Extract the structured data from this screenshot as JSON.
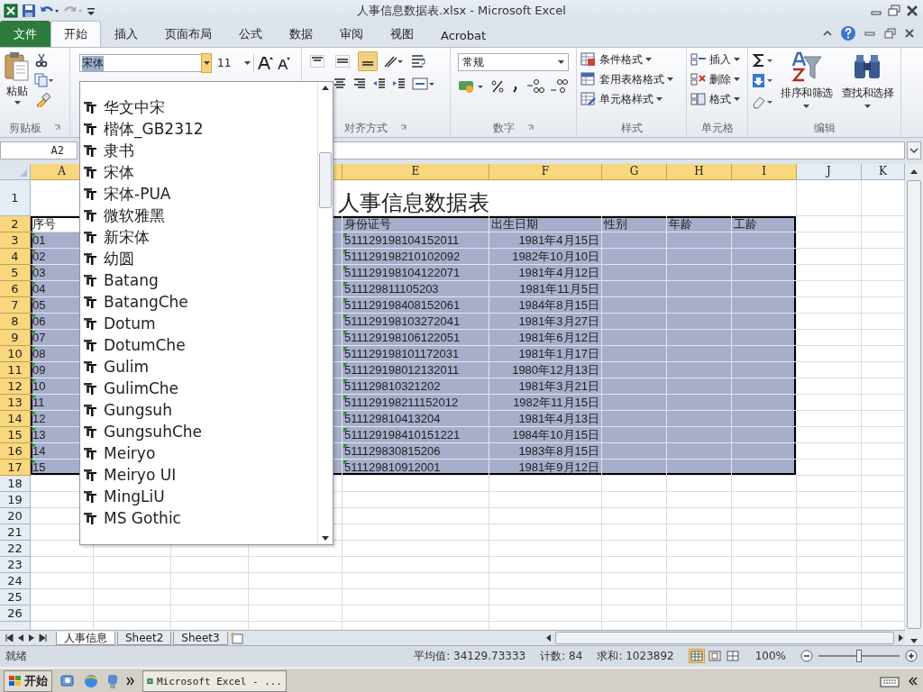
{
  "window": {
    "title": "人事信息数据表.xlsx - Microsoft Excel"
  },
  "ribbon_tabs": [
    {
      "label": "文件",
      "kind": "file",
      "selected": false
    },
    {
      "label": "开始",
      "kind": "tab",
      "selected": true
    },
    {
      "label": "插入",
      "kind": "tab",
      "selected": false
    },
    {
      "label": "页面布局",
      "kind": "tab",
      "selected": false
    },
    {
      "label": "公式",
      "kind": "tab",
      "selected": false
    },
    {
      "label": "数据",
      "kind": "tab",
      "selected": false
    },
    {
      "label": "审阅",
      "kind": "tab",
      "selected": false
    },
    {
      "label": "视图",
      "kind": "tab",
      "selected": false
    },
    {
      "label": "Acrobat",
      "kind": "tab",
      "selected": false
    }
  ],
  "clipboard": {
    "paste_label": "粘贴",
    "group_label": "剪贴板"
  },
  "font": {
    "name": "宋体",
    "size": "11"
  },
  "alignment": {
    "vertical": [
      {
        "selected": false
      },
      {
        "selected": false
      },
      {
        "selected": true
      }
    ],
    "group_label": "对齐方式"
  },
  "number": {
    "format": "常规",
    "group_label": "数字"
  },
  "styles": {
    "commands": [
      "条件格式",
      "套用表格格式",
      "单元格样式"
    ],
    "group_label": "样式"
  },
  "cells": {
    "commands": [
      "插入",
      "删除",
      "格式"
    ],
    "group_label": "单元格"
  },
  "editing": {
    "commands": [
      "排序和筛选",
      "查找和选择"
    ],
    "group_label": "编辑"
  },
  "name_box": "A2",
  "font_list": [
    "华文中宋",
    "楷体_GB2312",
    "隶书",
    "宋体",
    "宋体-PUA",
    "微软雅黑",
    "新宋体",
    "幼圆",
    "Batang",
    "BatangChe",
    "Dotum",
    "DotumChe",
    "Gulim",
    "GulimChe",
    "Gungsuh",
    "GungsuhChe",
    "Meiryo",
    "Meiryo UI",
    "MingLiU",
    "MS Gothic"
  ],
  "columns": [
    {
      "label": "A",
      "selected": true
    },
    {},
    {},
    {
      "selected": true
    },
    {
      "label": "E",
      "selected": true
    },
    {
      "label": "F",
      "selected": true
    },
    {
      "label": "G",
      "selected": true
    },
    {
      "label": "H",
      "selected": true
    },
    {
      "label": "I",
      "selected": true
    },
    {
      "label": "J",
      "selected": false
    },
    {
      "label": "K",
      "selected": false
    }
  ],
  "rows": [
    {
      "label": "1",
      "selected": false
    },
    {
      "label": "2",
      "selected": true
    },
    {
      "label": "3",
      "selected": true
    },
    {
      "label": "4",
      "selected": true
    },
    {
      "label": "5",
      "selected": true
    },
    {
      "label": "6",
      "selected": true
    },
    {
      "label": "7",
      "selected": true
    },
    {
      "label": "8",
      "selected": true
    },
    {
      "label": "9",
      "selected": true
    },
    {
      "label": "10",
      "selected": true
    },
    {
      "label": "11",
      "selected": true
    },
    {
      "label": "12",
      "selected": true
    },
    {
      "label": "13",
      "selected": true
    },
    {
      "label": "14",
      "selected": true
    },
    {
      "label": "15",
      "selected": true
    },
    {
      "label": "16",
      "selected": true
    },
    {
      "label": "17",
      "selected": true
    },
    {
      "label": "18",
      "selected": false
    },
    {
      "label": "19",
      "selected": false
    },
    {
      "label": "20",
      "selected": false
    },
    {
      "label": "21",
      "selected": false
    },
    {
      "label": "22",
      "selected": false
    },
    {
      "label": "23",
      "selected": false
    },
    {
      "label": "24",
      "selected": false
    },
    {
      "label": "25",
      "selected": false
    },
    {
      "label": "26",
      "selected": false
    }
  ],
  "sheet": {
    "title": "人事信息数据表",
    "header": [
      {
        "text": "序号",
        "active": true
      },
      {
        "text": "身份证号",
        "active": false
      },
      {
        "text": "出生日期",
        "active": false
      },
      {
        "text": "性别",
        "active": false
      },
      {
        "text": "年龄",
        "active": false
      },
      {
        "text": "工龄",
        "active": false
      }
    ],
    "records": [
      {
        "no": "01",
        "id_number": "511129198104152011",
        "birth_date": "1981年4月15日",
        "number_as_text": true
      },
      {
        "no": "02",
        "id_number": "511129198210102092",
        "birth_date": "1982年10月10日",
        "number_as_text": true
      },
      {
        "no": "03",
        "id_number": "511129198104122071",
        "birth_date": "1981年4月12日",
        "number_as_text": true
      },
      {
        "no": "04",
        "id_number": "511129811105203",
        "birth_date": "1981年11月5日",
        "number_as_text": true
      },
      {
        "no": "05",
        "id_number": "511129198408152061",
        "birth_date": "1984年8月15日",
        "number_as_text": true
      },
      {
        "no": "06",
        "id_number": "511129198103272041",
        "birth_date": "1981年3月27日",
        "number_as_text": true
      },
      {
        "no": "07",
        "id_number": "511129198106122051",
        "birth_date": "1981年6月12日",
        "number_as_text": true
      },
      {
        "no": "08",
        "id_number": "511129198101172031",
        "birth_date": "1981年1月17日",
        "number_as_text": true
      },
      {
        "no": "09",
        "id_number": "511129198012132011",
        "birth_date": "1980年12月13日",
        "number_as_text": true
      },
      {
        "no": "10",
        "id_number": "511129810321202",
        "birth_date": "1981年3月21日",
        "number_as_text": true
      },
      {
        "no": "11",
        "id_number": "511129198211152012",
        "birth_date": "1982年11月15日",
        "number_as_text": true
      },
      {
        "no": "12",
        "id_number": "511129810413204",
        "birth_date": "1981年4月13日",
        "number_as_text": true
      },
      {
        "no": "13",
        "id_number": "511129198410151221",
        "birth_date": "1984年10月15日",
        "number_as_text": true
      },
      {
        "no": "14",
        "id_number": "511129830815206",
        "birth_date": "1983年8月15日",
        "number_as_text": true
      },
      {
        "no": "15",
        "id_number": "511129810912001",
        "birth_date": "1981年9月12日",
        "number_as_text": true
      }
    ]
  },
  "sheet_tabs": [
    {
      "label": "人事信息",
      "selected": true
    },
    {
      "label": "Sheet2",
      "selected": false
    },
    {
      "label": "Sheet3",
      "selected": false
    }
  ],
  "status_bar": {
    "state": "就绪",
    "average": "平均值: 34129.73333",
    "count": "计数: 84",
    "sum": "求和: 1023892",
    "views": [
      {
        "selected": true
      },
      {
        "selected": false
      },
      {
        "selected": false
      }
    ],
    "zoom": "100%",
    "zoom_slider": {
      "level": 0.5
    }
  },
  "taskbar": {
    "start": "开始",
    "window": "Microsoft Excel - ..."
  }
}
